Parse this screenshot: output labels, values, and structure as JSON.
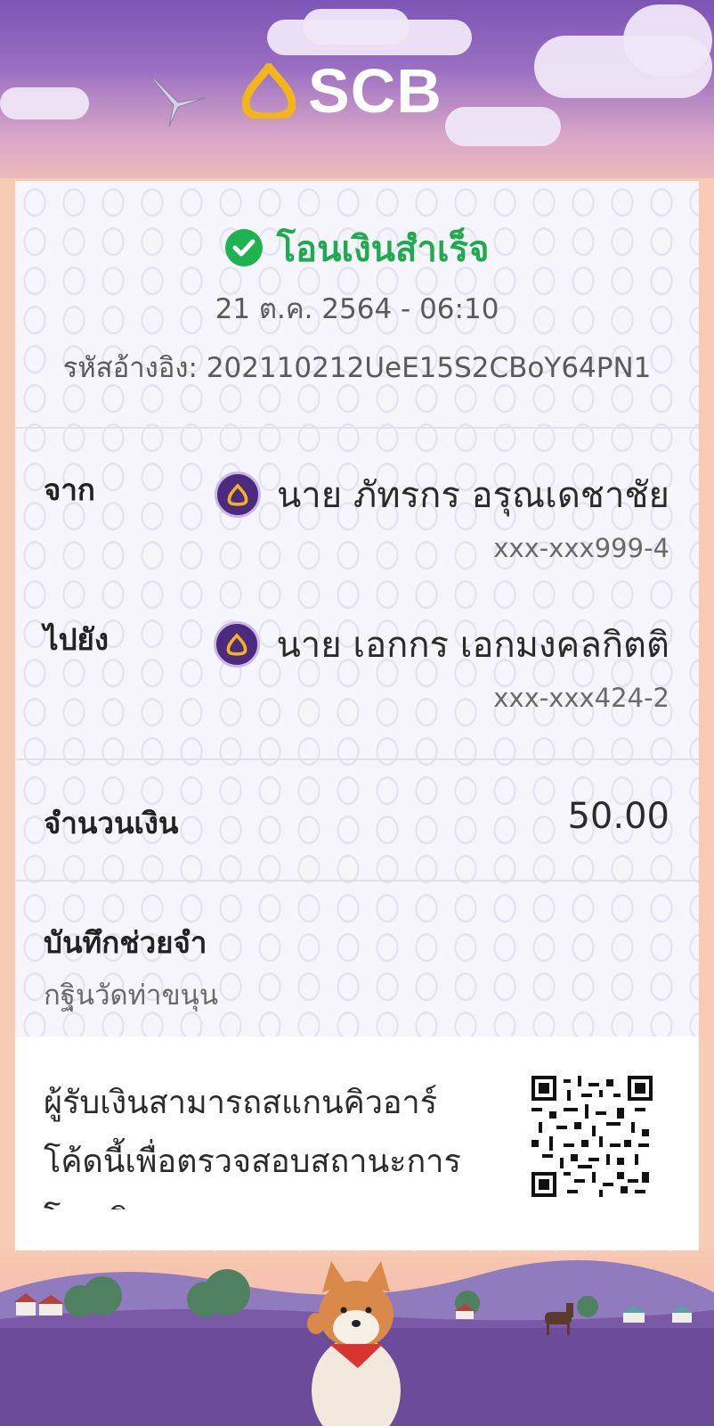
{
  "header": {
    "brand": "SCB"
  },
  "receipt": {
    "status": "โอนเงินสำเร็จ",
    "datetime": "21 ต.ค. 2564 - 06:10",
    "reference": "รหัสอ้างอิง: 202110212UeE15S2CBoY64PN1",
    "from": {
      "label": "จาก",
      "name": "นาย ภัทรกร อรุณเดชาชัย",
      "account": "xxx-xxx999-4"
    },
    "to": {
      "label": "ไปยัง",
      "name": "นาย เอกกร เอกมงคลกิตติ",
      "account": "xxx-xxx424-2"
    },
    "amount": {
      "label": "จำนวนเงิน",
      "value": "50.00"
    },
    "memo": {
      "label": "บันทึกช่วยจำ",
      "value": "กฐินวัดท่าขนุน"
    },
    "qr_note": "ผู้รับเงินสามารถสแกนคิวอาร์โค้ดนี้เพื่อตรวจสอบสถานะการโอนเงิน"
  },
  "colors": {
    "success": "#1faa4f",
    "brand_purple": "#4b2a80",
    "brand_gold": "#f2b51a"
  }
}
